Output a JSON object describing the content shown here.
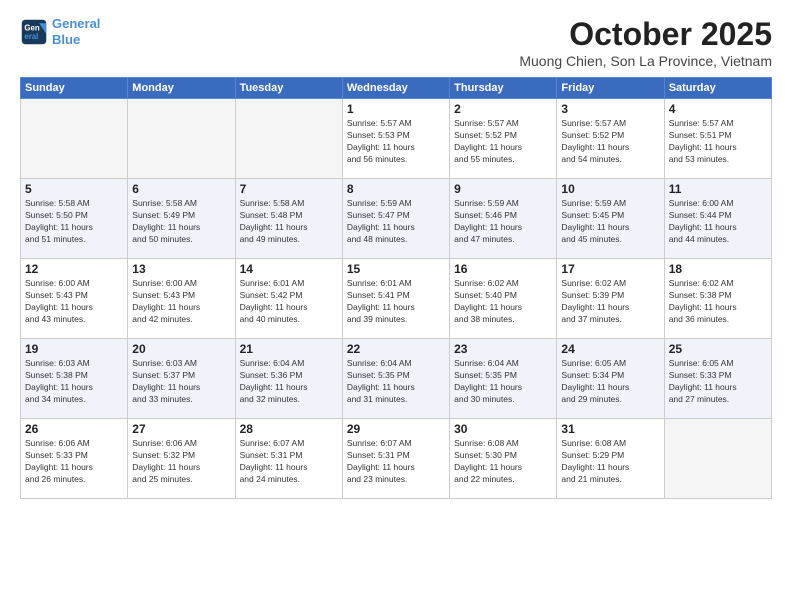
{
  "logo": {
    "line1": "General",
    "line2": "Blue"
  },
  "header": {
    "title": "October 2025",
    "subtitle": "Muong Chien, Son La Province, Vietnam"
  },
  "weekdays": [
    "Sunday",
    "Monday",
    "Tuesday",
    "Wednesday",
    "Thursday",
    "Friday",
    "Saturday"
  ],
  "weeks": [
    [
      {
        "day": "",
        "info": ""
      },
      {
        "day": "",
        "info": ""
      },
      {
        "day": "",
        "info": ""
      },
      {
        "day": "1",
        "info": "Sunrise: 5:57 AM\nSunset: 5:53 PM\nDaylight: 11 hours\nand 56 minutes."
      },
      {
        "day": "2",
        "info": "Sunrise: 5:57 AM\nSunset: 5:52 PM\nDaylight: 11 hours\nand 55 minutes."
      },
      {
        "day": "3",
        "info": "Sunrise: 5:57 AM\nSunset: 5:52 PM\nDaylight: 11 hours\nand 54 minutes."
      },
      {
        "day": "4",
        "info": "Sunrise: 5:57 AM\nSunset: 5:51 PM\nDaylight: 11 hours\nand 53 minutes."
      }
    ],
    [
      {
        "day": "5",
        "info": "Sunrise: 5:58 AM\nSunset: 5:50 PM\nDaylight: 11 hours\nand 51 minutes."
      },
      {
        "day": "6",
        "info": "Sunrise: 5:58 AM\nSunset: 5:49 PM\nDaylight: 11 hours\nand 50 minutes."
      },
      {
        "day": "7",
        "info": "Sunrise: 5:58 AM\nSunset: 5:48 PM\nDaylight: 11 hours\nand 49 minutes."
      },
      {
        "day": "8",
        "info": "Sunrise: 5:59 AM\nSunset: 5:47 PM\nDaylight: 11 hours\nand 48 minutes."
      },
      {
        "day": "9",
        "info": "Sunrise: 5:59 AM\nSunset: 5:46 PM\nDaylight: 11 hours\nand 47 minutes."
      },
      {
        "day": "10",
        "info": "Sunrise: 5:59 AM\nSunset: 5:45 PM\nDaylight: 11 hours\nand 45 minutes."
      },
      {
        "day": "11",
        "info": "Sunrise: 6:00 AM\nSunset: 5:44 PM\nDaylight: 11 hours\nand 44 minutes."
      }
    ],
    [
      {
        "day": "12",
        "info": "Sunrise: 6:00 AM\nSunset: 5:43 PM\nDaylight: 11 hours\nand 43 minutes."
      },
      {
        "day": "13",
        "info": "Sunrise: 6:00 AM\nSunset: 5:43 PM\nDaylight: 11 hours\nand 42 minutes."
      },
      {
        "day": "14",
        "info": "Sunrise: 6:01 AM\nSunset: 5:42 PM\nDaylight: 11 hours\nand 40 minutes."
      },
      {
        "day": "15",
        "info": "Sunrise: 6:01 AM\nSunset: 5:41 PM\nDaylight: 11 hours\nand 39 minutes."
      },
      {
        "day": "16",
        "info": "Sunrise: 6:02 AM\nSunset: 5:40 PM\nDaylight: 11 hours\nand 38 minutes."
      },
      {
        "day": "17",
        "info": "Sunrise: 6:02 AM\nSunset: 5:39 PM\nDaylight: 11 hours\nand 37 minutes."
      },
      {
        "day": "18",
        "info": "Sunrise: 6:02 AM\nSunset: 5:38 PM\nDaylight: 11 hours\nand 36 minutes."
      }
    ],
    [
      {
        "day": "19",
        "info": "Sunrise: 6:03 AM\nSunset: 5:38 PM\nDaylight: 11 hours\nand 34 minutes."
      },
      {
        "day": "20",
        "info": "Sunrise: 6:03 AM\nSunset: 5:37 PM\nDaylight: 11 hours\nand 33 minutes."
      },
      {
        "day": "21",
        "info": "Sunrise: 6:04 AM\nSunset: 5:36 PM\nDaylight: 11 hours\nand 32 minutes."
      },
      {
        "day": "22",
        "info": "Sunrise: 6:04 AM\nSunset: 5:35 PM\nDaylight: 11 hours\nand 31 minutes."
      },
      {
        "day": "23",
        "info": "Sunrise: 6:04 AM\nSunset: 5:35 PM\nDaylight: 11 hours\nand 30 minutes."
      },
      {
        "day": "24",
        "info": "Sunrise: 6:05 AM\nSunset: 5:34 PM\nDaylight: 11 hours\nand 29 minutes."
      },
      {
        "day": "25",
        "info": "Sunrise: 6:05 AM\nSunset: 5:33 PM\nDaylight: 11 hours\nand 27 minutes."
      }
    ],
    [
      {
        "day": "26",
        "info": "Sunrise: 6:06 AM\nSunset: 5:33 PM\nDaylight: 11 hours\nand 26 minutes."
      },
      {
        "day": "27",
        "info": "Sunrise: 6:06 AM\nSunset: 5:32 PM\nDaylight: 11 hours\nand 25 minutes."
      },
      {
        "day": "28",
        "info": "Sunrise: 6:07 AM\nSunset: 5:31 PM\nDaylight: 11 hours\nand 24 minutes."
      },
      {
        "day": "29",
        "info": "Sunrise: 6:07 AM\nSunset: 5:31 PM\nDaylight: 11 hours\nand 23 minutes."
      },
      {
        "day": "30",
        "info": "Sunrise: 6:08 AM\nSunset: 5:30 PM\nDaylight: 11 hours\nand 22 minutes."
      },
      {
        "day": "31",
        "info": "Sunrise: 6:08 AM\nSunset: 5:29 PM\nDaylight: 11 hours\nand 21 minutes."
      },
      {
        "day": "",
        "info": ""
      }
    ]
  ]
}
